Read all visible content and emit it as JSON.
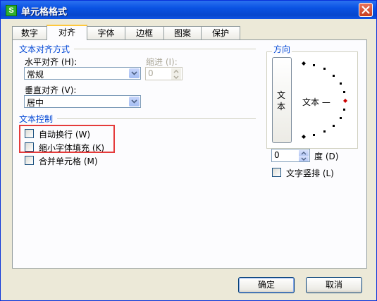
{
  "window": {
    "title": "单元格格式",
    "app_icon_letter": "S"
  },
  "tabs": [
    {
      "label": "数字",
      "active": false
    },
    {
      "label": "对齐",
      "active": true
    },
    {
      "label": "字体",
      "active": false
    },
    {
      "label": "边框",
      "active": false
    },
    {
      "label": "图案",
      "active": false
    },
    {
      "label": "保护",
      "active": false
    }
  ],
  "text_alignment": {
    "group_label": "文本对齐方式",
    "horizontal": {
      "label": "水平对齐 (H):",
      "value": "常规"
    },
    "indent": {
      "label": "缩进 (I):",
      "value": "0"
    },
    "vertical": {
      "label": "垂直对齐 (V):",
      "value": "居中"
    }
  },
  "text_control": {
    "group_label": "文本控制",
    "wrap_text": {
      "label": "自动换行 (W)",
      "checked": false
    },
    "shrink_to_fit": {
      "label": "缩小字体填充 (K)",
      "checked": false
    },
    "merge_cells": {
      "label": "合并单元格 (M)",
      "checked": false
    }
  },
  "orientation": {
    "group_label": "方向",
    "vertical_text_chars": [
      "文",
      "本"
    ],
    "dial_text": "文本 —",
    "degrees": {
      "value": "0",
      "label": "度 (D)"
    },
    "vertical_layout": {
      "label": "文字竖排 (L)",
      "checked": false
    }
  },
  "buttons": {
    "ok": "确定",
    "cancel": "取消"
  },
  "colors": {
    "title_bar": "#0a52e3",
    "group_label": "#0046d5",
    "highlight": "#e53b3b",
    "dial_marker": "#cc0000"
  }
}
